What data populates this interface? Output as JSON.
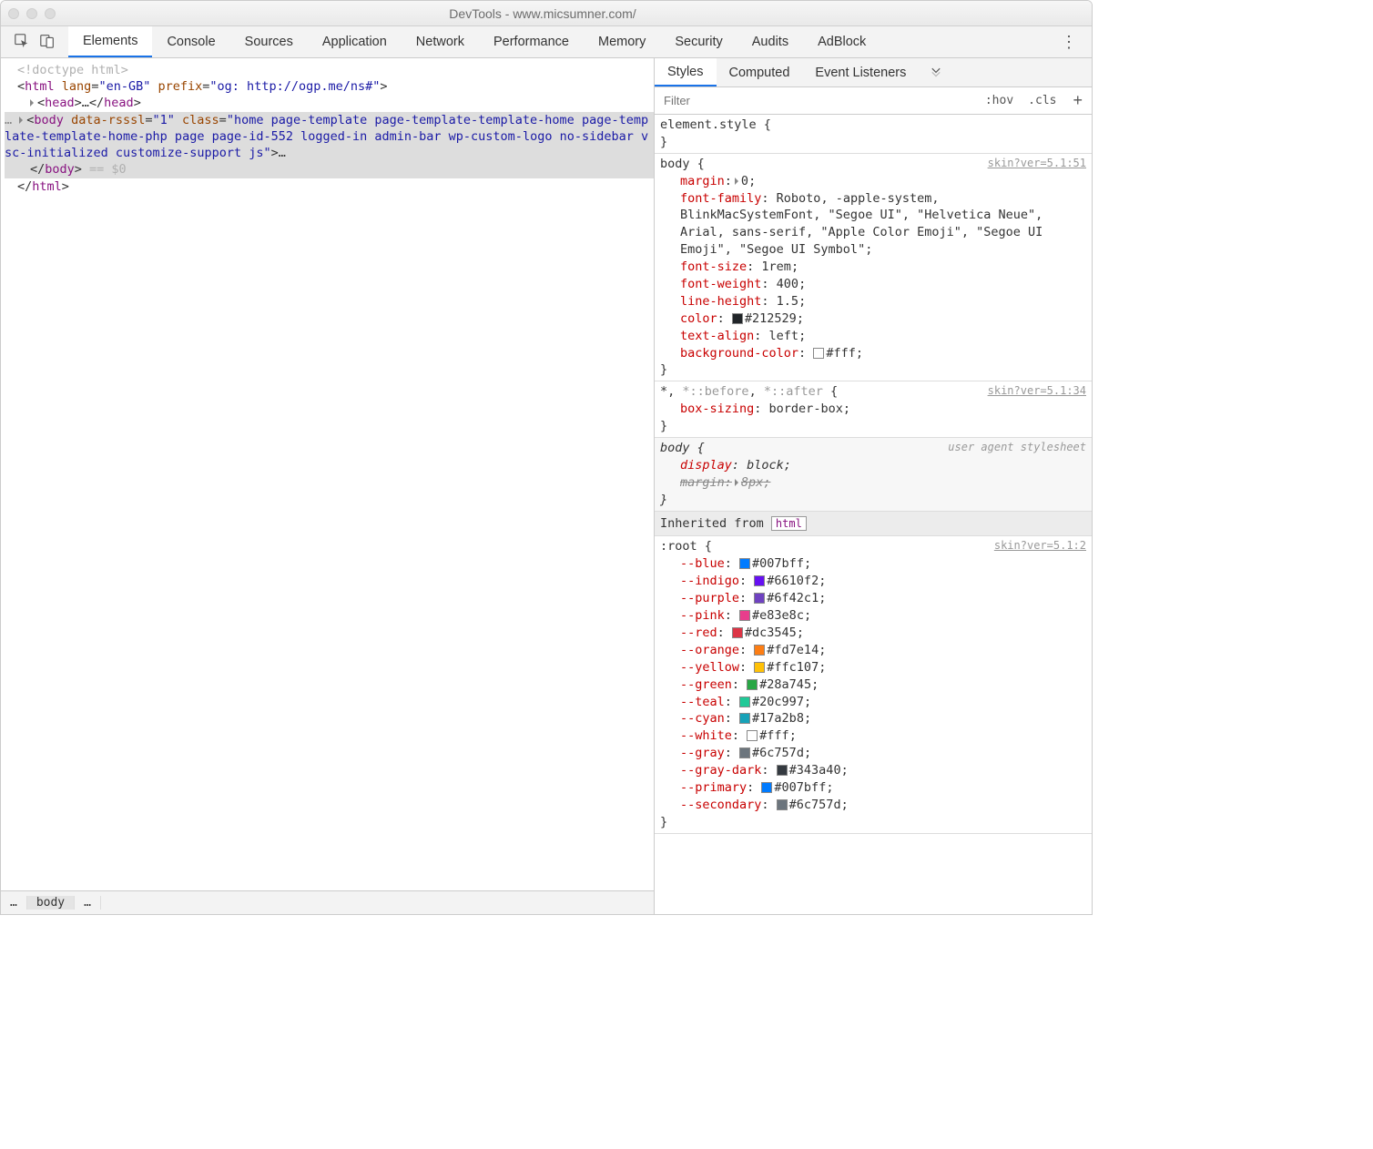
{
  "window": {
    "title": "DevTools - www.micsumner.com/"
  },
  "mainTabs": [
    "Elements",
    "Console",
    "Sources",
    "Application",
    "Network",
    "Performance",
    "Memory",
    "Security",
    "Audits",
    "AdBlock"
  ],
  "activeMainTab": "Elements",
  "subTabs": [
    "Styles",
    "Computed",
    "Event Listeners"
  ],
  "activeSubTab": "Styles",
  "filter": {
    "placeholder": "Filter",
    "hov": ":hov",
    "cls": ".cls"
  },
  "breadcrumbs": {
    "left": "…",
    "selected": "body",
    "right": "…"
  },
  "dom": {
    "doctype": "<!doctype html>",
    "htmlOpen": {
      "tag": "html",
      "attrs": [
        [
          "lang",
          "en-GB"
        ],
        [
          "prefix",
          "og: http://ogp.me/ns#"
        ]
      ]
    },
    "headCollapsed": {
      "open": "<head>",
      "ellipsis": "…",
      "close": "</head>"
    },
    "bodyOpen": {
      "tag": "body",
      "attrs": [
        [
          "data-rsssl",
          "1"
        ],
        [
          "class",
          "home page-template page-template-template-home page-template-template-home-php page page-id-552 logged-in admin-bar wp-custom-logo no-sidebar vsc-initialized customize-support js"
        ]
      ],
      "trailingEllipsis": "…"
    },
    "bodyClose": "</body>",
    "eqDollar0": " == $0",
    "htmlClose": "</html>",
    "selEllipsis": "…"
  },
  "rules": [
    {
      "selector": "element.style",
      "props": []
    },
    {
      "selector": "body",
      "origin": "skin?ver=5.1:51",
      "props": [
        {
          "name": "margin",
          "value": "0",
          "tri": true
        },
        {
          "name": "font-family",
          "value": "Roboto, -apple-system, BlinkMacSystemFont, \"Segoe UI\", \"Helvetica Neue\", Arial, sans-serif, \"Apple Color Emoji\", \"Segoe UI Emoji\", \"Segoe UI Symbol\""
        },
        {
          "name": "font-size",
          "value": "1rem"
        },
        {
          "name": "font-weight",
          "value": "400"
        },
        {
          "name": "line-height",
          "value": "1.5"
        },
        {
          "name": "color",
          "value": "#212529",
          "swatch": "#212529"
        },
        {
          "name": "text-align",
          "value": "left"
        },
        {
          "name": "background-color",
          "value": "#fff",
          "swatch": "#ffffff"
        }
      ]
    },
    {
      "selectorParts": [
        {
          "t": "*",
          "active": true
        },
        {
          "t": ", "
        },
        {
          "t": "*::before",
          "active": false
        },
        {
          "t": ", "
        },
        {
          "t": "*::after",
          "active": false
        }
      ],
      "origin": "skin?ver=5.1:34",
      "props": [
        {
          "name": "box-sizing",
          "value": "border-box"
        }
      ]
    },
    {
      "selector": "body",
      "ua": true,
      "originLabel": "user agent stylesheet",
      "props": [
        {
          "name": "display",
          "value": "block",
          "italic": true
        },
        {
          "name": "margin",
          "value": "8px",
          "tri": true,
          "strike": true,
          "italic": true
        }
      ]
    },
    {
      "inheritedFrom": "html"
    },
    {
      "selector": ":root",
      "origin": "skin?ver=5.1:2",
      "props": [
        {
          "name": "--blue",
          "value": "#007bff",
          "swatch": "#007bff"
        },
        {
          "name": "--indigo",
          "value": "#6610f2",
          "swatch": "#6610f2"
        },
        {
          "name": "--purple",
          "value": "#6f42c1",
          "swatch": "#6f42c1"
        },
        {
          "name": "--pink",
          "value": "#e83e8c",
          "swatch": "#e83e8c"
        },
        {
          "name": "--red",
          "value": "#dc3545",
          "swatch": "#dc3545"
        },
        {
          "name": "--orange",
          "value": "#fd7e14",
          "swatch": "#fd7e14"
        },
        {
          "name": "--yellow",
          "value": "#ffc107",
          "swatch": "#ffc107"
        },
        {
          "name": "--green",
          "value": "#28a745",
          "swatch": "#28a745"
        },
        {
          "name": "--teal",
          "value": "#20c997",
          "swatch": "#20c997"
        },
        {
          "name": "--cyan",
          "value": "#17a2b8",
          "swatch": "#17a2b8"
        },
        {
          "name": "--white",
          "value": "#fff",
          "swatch": "#ffffff"
        },
        {
          "name": "--gray",
          "value": "#6c757d",
          "swatch": "#6c757d"
        },
        {
          "name": "--gray-dark",
          "value": "#343a40",
          "swatch": "#343a40"
        },
        {
          "name": "--primary",
          "value": "#007bff",
          "swatch": "#007bff"
        },
        {
          "name": "--secondary",
          "value": "#6c757d",
          "swatch": "#6c757d"
        }
      ]
    }
  ]
}
